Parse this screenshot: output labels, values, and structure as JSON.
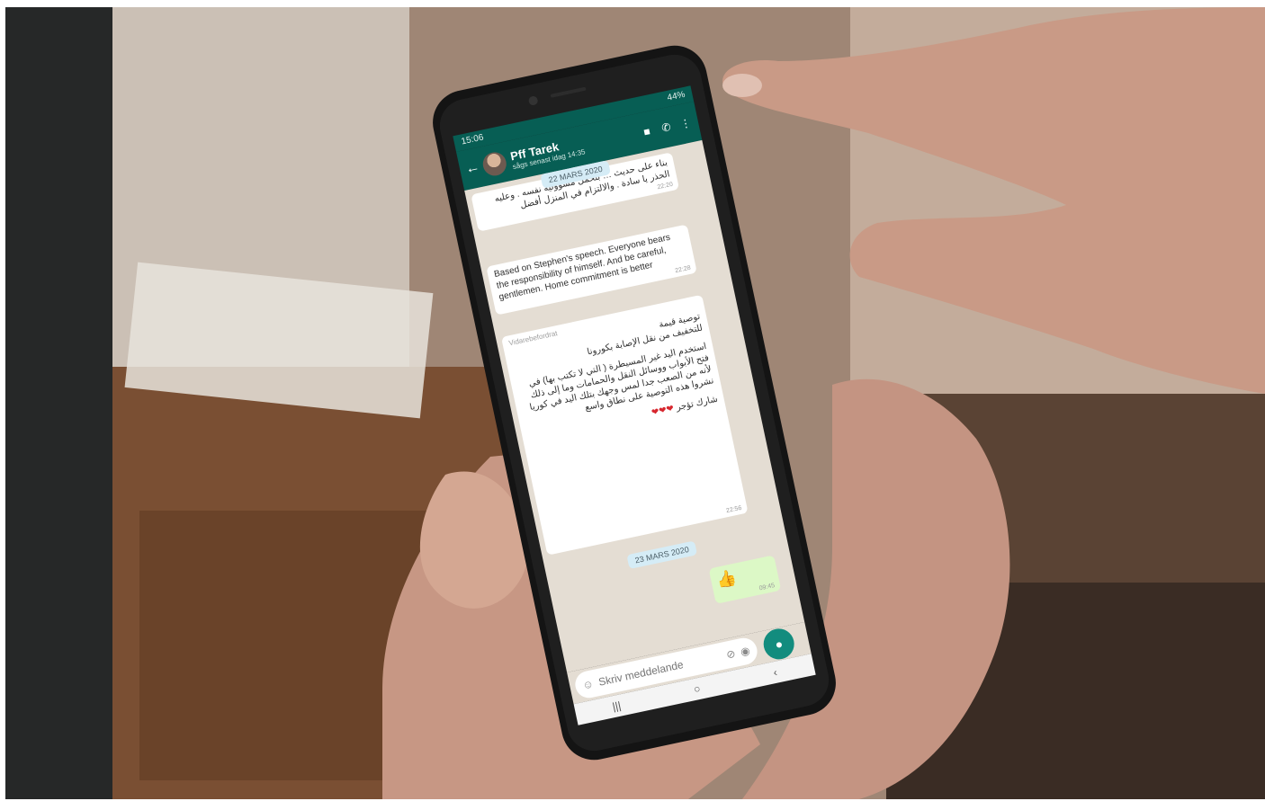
{
  "phone": {
    "status": {
      "time": "15:06",
      "battery": "44%"
    },
    "header": {
      "name": "Pff Tarek",
      "last_seen": "sågs senast idag 14:35"
    },
    "date_1": "22 MARS 2020",
    "msg_ar_1": "بناء على حديث … بتحمل مسؤولية نفسه . وعليه الحذر يا سادة . والالتزام في المنزل أفضل",
    "msg_ar_1_time": "22:20",
    "msg_en": "Based on Stephen's speech. Everyone bears the responsibility of himself.  And be careful, gentlemen. Home commitment is better",
    "msg_en_time": "22:28",
    "msg_fwd": {
      "label": "Vidarebefordrat",
      "line1": "توصية قيمة",
      "line2": "للتخفيف من نقل الإصابة بكورونا",
      "line3": "استخدم اليد غير المسيطرة ( التي لا تكتب بها) في فتح الأبواب ووسائل النقل والحمامات وما إلى ذلك لأنه من الصعب جدا لمس وجهك بتلك اليد في كوريا نشروا هذه التوصية على نطاق واسع",
      "line4": "شارك تؤجر",
      "hearts": "❤❤❤",
      "time": "22:56"
    },
    "date_2": "23 MARS 2020",
    "msg_out": {
      "emoji": "👍",
      "time": "09:45"
    },
    "input_placeholder": "Skriv meddelande"
  },
  "colors": {
    "header_green": "#075e54",
    "mic_green": "#128c7e",
    "chat_bg": "#e4ddd3",
    "out_bubble": "#dcf8c6",
    "date_chip": "#d5ecf6",
    "side_bar": "#262828"
  }
}
